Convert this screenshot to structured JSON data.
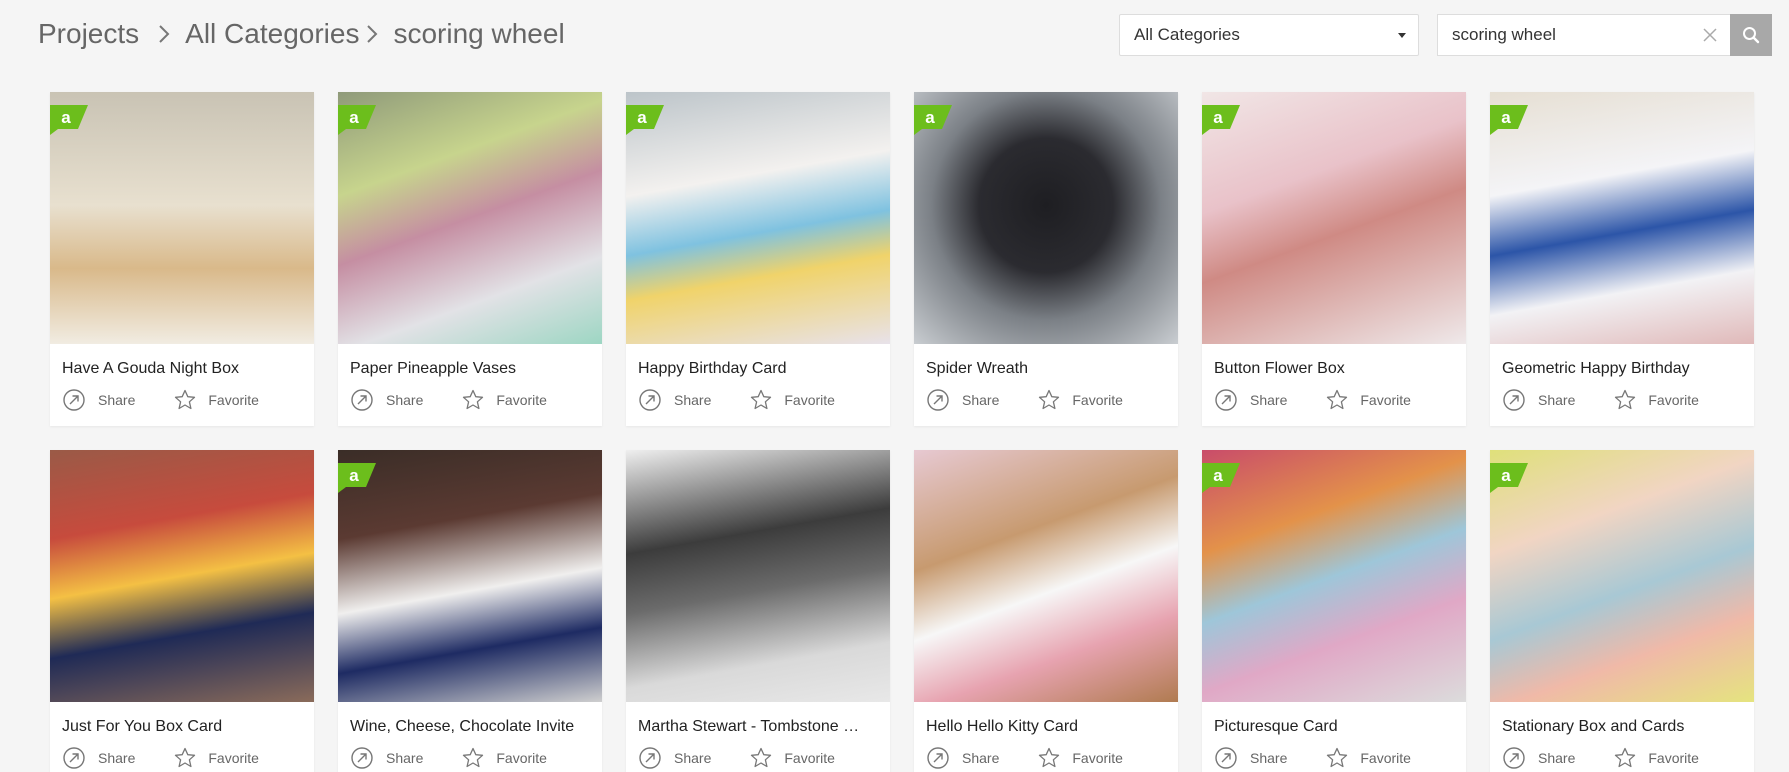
{
  "breadcrumb": {
    "items": [
      "Projects",
      "All Categories",
      "scoring wheel"
    ]
  },
  "category_select": {
    "selected": "All Categories"
  },
  "search": {
    "value": "scoring wheel"
  },
  "colors": {
    "badge_green": "#6cbe1c",
    "search_button": "#a8a8a8",
    "background": "#f5f5f5"
  },
  "cards": [
    {
      "title": "Have A Gouda Night Box",
      "share": "Share",
      "favorite": "Favorite",
      "badge": true,
      "bg": "linear-gradient(180deg,#c9c3b4 0%,#e8e0cf 45%,#d9b98a 70%,#f1ece2 100%)"
    },
    {
      "title": "Paper Pineapple Vases",
      "share": "Share",
      "favorite": "Favorite",
      "badge": true,
      "bg": "linear-gradient(160deg,#8f9a7a 0%,#c7d48d 30%,#c58ea2 50%,#e2e2e6 75%,#9dd6c3 100%)"
    },
    {
      "title": "Happy Birthday Card",
      "share": "Share",
      "favorite": "Favorite",
      "badge": true,
      "bg": "linear-gradient(170deg,#bcc4c9 0%,#f3f1ef 35%,#7fc2e0 55%,#f0d36a 70%,#e8e2ea 100%)"
    },
    {
      "title": "Spider Wreath",
      "share": "Share",
      "favorite": "Favorite",
      "badge": true,
      "bg": "radial-gradient(circle at 50% 45%,#1e1e22 0%,#2b2b30 35%,#7b8086 60%,#c9cdd1 100%)"
    },
    {
      "title": "Button Flower Box",
      "share": "Share",
      "favorite": "Favorite",
      "badge": true,
      "bg": "linear-gradient(160deg,#f1e6e6 0%,#e9c2c9 35%,#cf8a84 55%,#efe9ea 100%)"
    },
    {
      "title": "Geometric Happy Birthday",
      "share": "Share",
      "favorite": "Favorite",
      "badge": true,
      "bg": "linear-gradient(170deg,#e6dfd3 0%,#f4f4f7 35%,#2c55a8 55%,#f2f2f5 75%,#e0b9b9 100%)"
    },
    {
      "title": "Just For You Box Card",
      "share": "Share",
      "favorite": "Favorite",
      "badge": false,
      "bg": "linear-gradient(170deg,#9a5a47 0%,#c74b3d 30%,#f4c044 50%,#1f2a56 70%,#8a6b5a 100%)"
    },
    {
      "title": "Wine, Cheese, Chocolate Invite",
      "share": "Share",
      "favorite": "Favorite",
      "badge": true,
      "bg": "linear-gradient(170deg,#3a2d27 0%,#5b3a32 30%,#f0efee 55%,#1e2b63 75%,#cfcfcf 100%)"
    },
    {
      "title": "Martha Stewart - Tombstone …",
      "share": "Share",
      "favorite": "Favorite",
      "badge": false,
      "bg": "linear-gradient(170deg,#efefef 0%,#3c3c3c 35%,#6b6b6b 55%,#d9d9d9 80%,#e8e8e8 100%)"
    },
    {
      "title": "Hello Hello Kitty Card",
      "share": "Share",
      "favorite": "Favorite",
      "badge": false,
      "bg": "linear-gradient(160deg,#e7c9d2 0%,#c79a6f 35%,#f7f7f7 55%,#e7a3b0 75%,#b07b50 100%)"
    },
    {
      "title": "Picturesque Card",
      "share": "Share",
      "favorite": "Favorite",
      "badge": true,
      "bg": "linear-gradient(160deg,#c94c6a 0%,#e3924a 30%,#9ec6d9 50%,#e0a8c6 70%,#dcdcdc 100%)"
    },
    {
      "title": "Stationary Box and Cards",
      "share": "Share",
      "favorite": "Favorite",
      "badge": true,
      "bg": "linear-gradient(160deg,#dfe07a 0%,#f1d5c3 30%,#a8c8d4 55%,#f0b9a8 75%,#e5e47f 100%)"
    }
  ]
}
